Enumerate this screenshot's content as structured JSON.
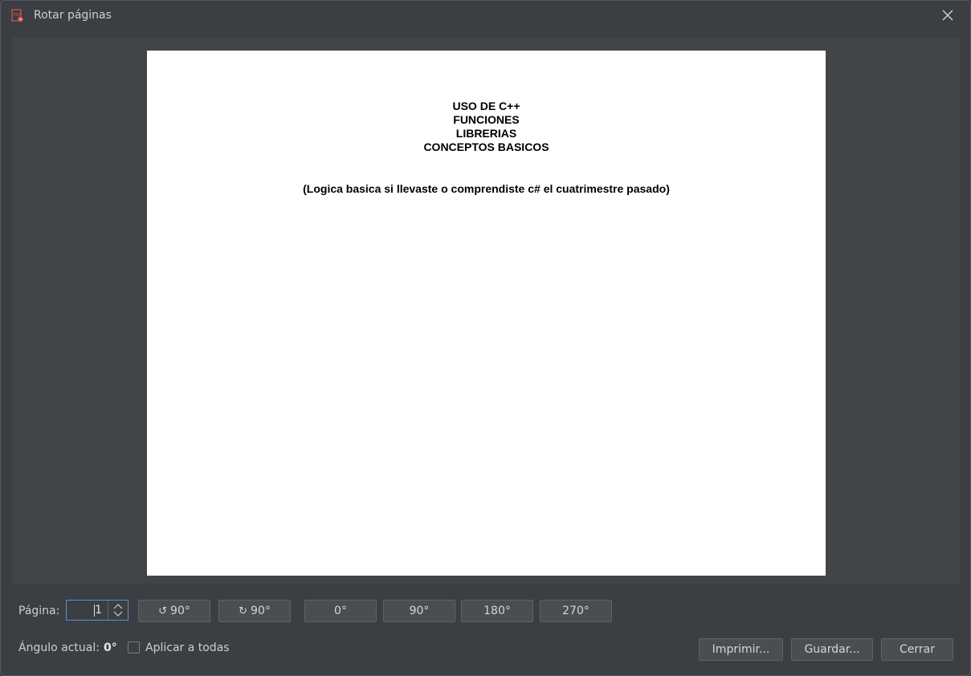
{
  "window": {
    "title": "Rotar páginas"
  },
  "document": {
    "title_lines": [
      "USO DE C++",
      "FUNCIONES",
      "LIBRERIAS",
      "CONCEPTOS BASICOS"
    ],
    "subtitle": "(Logica basica si llevaste o comprendiste c# el cuatrimestre pasado)"
  },
  "controls": {
    "page_label": "Página:",
    "page_value": "1",
    "rotate_ccw_label": "90°",
    "rotate_cw_label": "90°",
    "angle_buttons": [
      "0°",
      "90°",
      "180°",
      "270°"
    ],
    "current_angle_label": "Ángulo actual:",
    "current_angle_value": "0°",
    "apply_all_label": "Aplicar a todas",
    "apply_all_checked": false,
    "print_label": "Imprimir...",
    "save_label": "Guardar...",
    "close_label": "Cerrar"
  },
  "icons": {
    "app": "pdf-app-icon",
    "close": "close-icon",
    "rotate_ccw": "rotate-ccw-icon",
    "rotate_cw": "rotate-cw-icon"
  }
}
